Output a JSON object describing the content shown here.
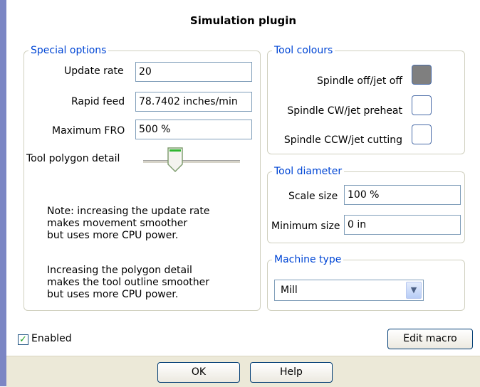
{
  "title": "Simulation plugin",
  "special_options": {
    "legend": "Special options",
    "update_rate_label": "Update rate",
    "update_rate_value": "20",
    "rapid_feed_label": "Rapid feed",
    "rapid_feed_value": "78.7402 inches/min",
    "max_fro_label": "Maximum FRO",
    "max_fro_value": "500 %",
    "polygon_detail_label": "Tool polygon detail",
    "polygon_detail_level": 0.3,
    "note1": [
      "Note: increasing the update rate",
      "makes movement smoother",
      "but uses more CPU power."
    ],
    "note2": [
      "Increasing the polygon detail",
      "makes the tool outline smoother",
      "but uses more CPU power."
    ]
  },
  "tool_colours": {
    "legend": "Tool colours",
    "items": [
      {
        "label": "Spindle off/jet off",
        "color": "#7f7f7f"
      },
      {
        "label": "Spindle CW/jet preheat",
        "color": "#ffffff"
      },
      {
        "label": "Spindle CCW/jet cutting",
        "color": "#ffffff"
      }
    ]
  },
  "tool_diameter": {
    "legend": "Tool diameter",
    "scale_label": "Scale size",
    "scale_value": "100 %",
    "min_label": "Minimum size",
    "min_value": "0 in"
  },
  "machine_type": {
    "legend": "Machine type",
    "selected": "Mill"
  },
  "enabled": {
    "label": "Enabled",
    "checked": true
  },
  "buttons": {
    "edit_macro": "Edit macro",
    "ok": "OK",
    "help": "Help"
  },
  "icons": {
    "check": "check-icon",
    "dropdown": "chevron-down-icon",
    "slider": "slider-thumb-icon"
  }
}
